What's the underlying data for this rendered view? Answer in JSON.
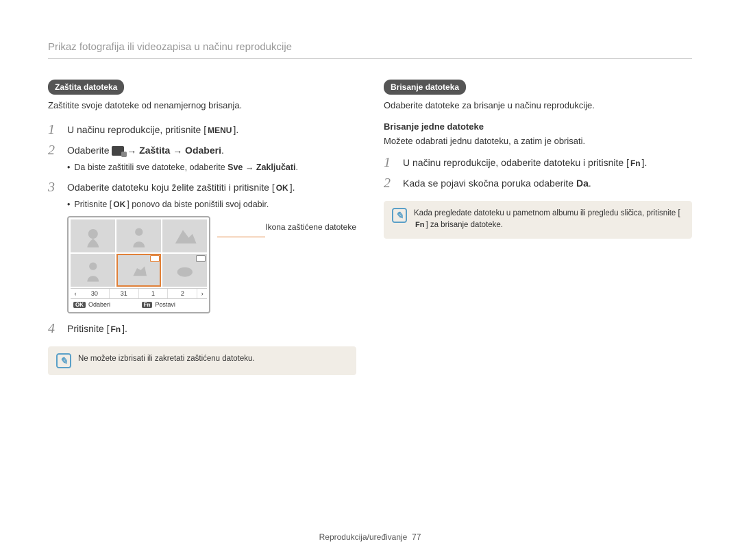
{
  "header": {
    "title": "Prikaz fotografija ili videozapisa u načinu reprodukcije"
  },
  "left": {
    "pill": "Zaštita datoteka",
    "lead": "Zaštitite svoje datoteke od nenamjernog brisanja.",
    "step1_pre": "U načinu reprodukcije, pritisnite [",
    "step1_key": "MENU",
    "step1_post": "].",
    "step2_pre": "Odaberite ",
    "step2_bold": " → Zaštita → Odaberi",
    "step2_post": ".",
    "bullet1_pre": "Da biste zaštitili sve datoteke, odaberite ",
    "bullet1_bold1": "Sve",
    "bullet1_arrow": " → ",
    "bullet1_bold2": "Zaključati",
    "bullet1_post": ".",
    "step3_pre": "Odaberite datoteku koju želite zaštititi i pritisnite [",
    "step3_key": "OK",
    "step3_post": "].",
    "bullet2_pre": "Pritisnite [",
    "bullet2_key": "OK",
    "bullet2_post": "] ponovo da biste poništili svoj odabir.",
    "callout": "Ikona zaštićene datoteke",
    "device": {
      "dates": [
        "30",
        "31",
        "1",
        "2"
      ],
      "action_ok": "OK",
      "action_ok_label": "Odaberi",
      "action_fn": "Fn",
      "action_fn_label": "Postavi"
    },
    "step4_pre": "Pritisnite [",
    "step4_key": "Fn",
    "step4_post": "].",
    "note": "Ne možete izbrisati ili zakretati zaštićenu datoteku."
  },
  "right": {
    "pill": "Brisanje datoteka",
    "lead": "Odaberite datoteke za brisanje u načinu reprodukcije.",
    "subhead": "Brisanje jedne datoteke",
    "sublead": "Možete odabrati jednu datoteku, a zatim je obrisati.",
    "step1_pre": "U načinu reprodukcije, odaberite datoteku i pritisnite [",
    "step1_key": "Fn",
    "step1_post": "].",
    "step2_pre": "Kada se pojavi skočna poruka odaberite ",
    "step2_bold": "Da",
    "step2_post": ".",
    "note_pre": "Kada pregledate datoteku u pametnom albumu ili pregledu sličica, pritisnite [",
    "note_key": "Fn",
    "note_post": "] za brisanje datoteke."
  },
  "footer": {
    "section": "Reprodukcija/uređivanje",
    "page": "77"
  }
}
